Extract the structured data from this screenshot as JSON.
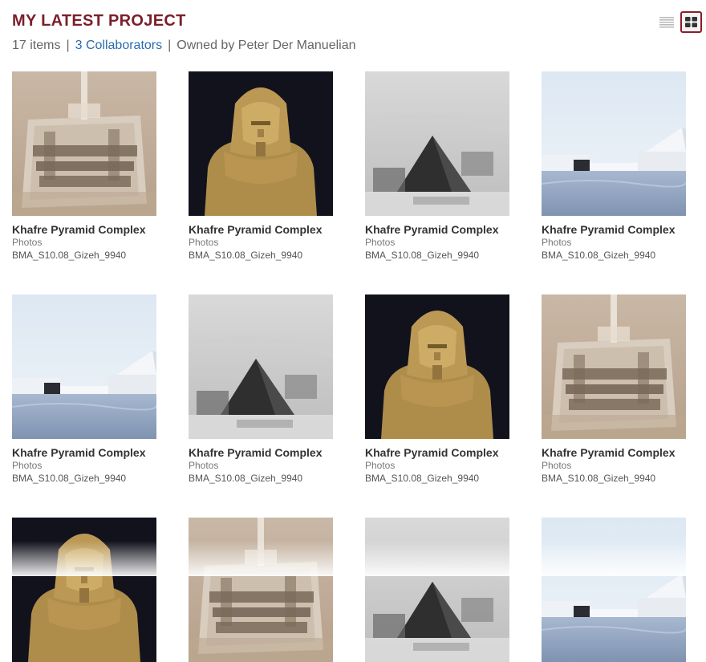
{
  "project": {
    "title": "MY LATEST PROJECT",
    "item_count": "17 items",
    "collaborators": "3 Collaborators",
    "owner": "Owned by Peter Der Manuelian",
    "separator": "|"
  },
  "view_toggle": {
    "list_icon": "list-view-icon",
    "grid_icon": "grid-view-icon",
    "active": "grid"
  },
  "colors": {
    "title": "#7a1f2b",
    "link": "#2a6bb0",
    "active_border": "#8c1d2a"
  },
  "items": [
    {
      "title": "Khafre Pyramid Complex",
      "type": "Photos",
      "id": "BMA_S10.08_Gizeh_9940",
      "image": "aerial"
    },
    {
      "title": "Khafre Pyramid Complex",
      "type": "Photos",
      "id": "BMA_S10.08_Gizeh_9940",
      "image": "statue"
    },
    {
      "title": "Khafre Pyramid Complex",
      "type": "Photos",
      "id": "BMA_S10.08_Gizeh_9940",
      "image": "bw-pyramid"
    },
    {
      "title": "Khafre Pyramid Complex",
      "type": "Photos",
      "id": "BMA_S10.08_Gizeh_9940",
      "image": "render"
    },
    {
      "title": "Khafre Pyramid Complex",
      "type": "Photos",
      "id": "BMA_S10.08_Gizeh_9940",
      "image": "render"
    },
    {
      "title": "Khafre Pyramid Complex",
      "type": "Photos",
      "id": "BMA_S10.08_Gizeh_9940",
      "image": "bw-pyramid"
    },
    {
      "title": "Khafre Pyramid Complex",
      "type": "Photos",
      "id": "BMA_S10.08_Gizeh_9940",
      "image": "statue"
    },
    {
      "title": "Khafre Pyramid Complex",
      "type": "Photos",
      "id": "BMA_S10.08_Gizeh_9940",
      "image": "aerial"
    },
    {
      "title": "",
      "type": "",
      "id": "",
      "image": "statue"
    },
    {
      "title": "",
      "type": "",
      "id": "",
      "image": "aerial"
    },
    {
      "title": "",
      "type": "",
      "id": "",
      "image": "bw-pyramid"
    },
    {
      "title": "",
      "type": "",
      "id": "",
      "image": "render"
    }
  ]
}
